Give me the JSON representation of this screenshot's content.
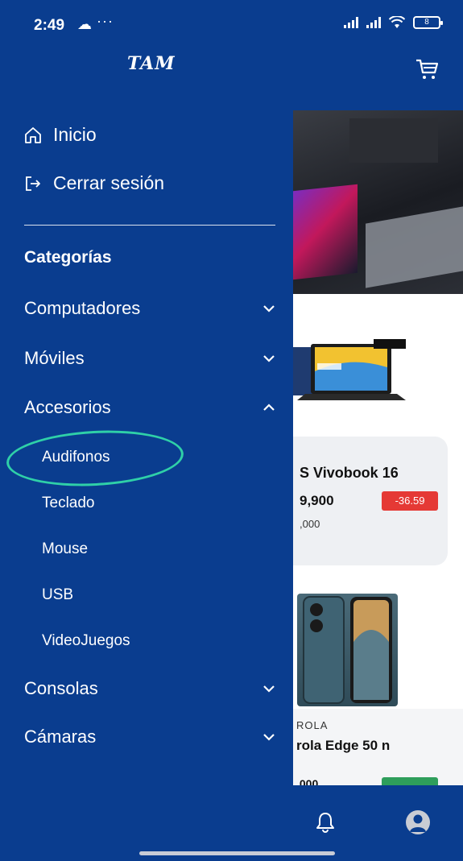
{
  "status_bar": {
    "time": "2:49",
    "dots": "···",
    "battery": "8"
  },
  "header": {
    "logo": "TAM",
    "cart_icon": "cart-icon"
  },
  "drawer": {
    "home_label": "Inicio",
    "logout_label": "Cerrar sesión",
    "categories_title": "Categorías",
    "categories": [
      {
        "label": "Computadores",
        "expanded": false
      },
      {
        "label": "Móviles",
        "expanded": false
      },
      {
        "label": "Accesorios",
        "expanded": true
      },
      {
        "label": "Consolas",
        "expanded": false
      },
      {
        "label": "Cámaras",
        "expanded": false
      }
    ],
    "subcategories": [
      "Audifonos",
      "Teclado",
      "Mouse",
      "USB",
      "VideoJuegos"
    ],
    "highlighted_subcategory": "Audifonos"
  },
  "background": {
    "product1_title": "S Vivobook 16",
    "product1_price": "9,900",
    "product1_old_price": ",000",
    "product1_discount": "-36.59",
    "product2_brand": "ROLA",
    "product2_title": "rola Edge 50 n",
    "product2_price": ".000"
  },
  "colors": {
    "primary": "#0a3d8f",
    "discount_red": "#e53935",
    "discount_green": "#2e9e5b",
    "highlight": "#2fd0a8"
  },
  "bottom_nav": {
    "icons": [
      "bell-icon",
      "profile-icon"
    ]
  }
}
